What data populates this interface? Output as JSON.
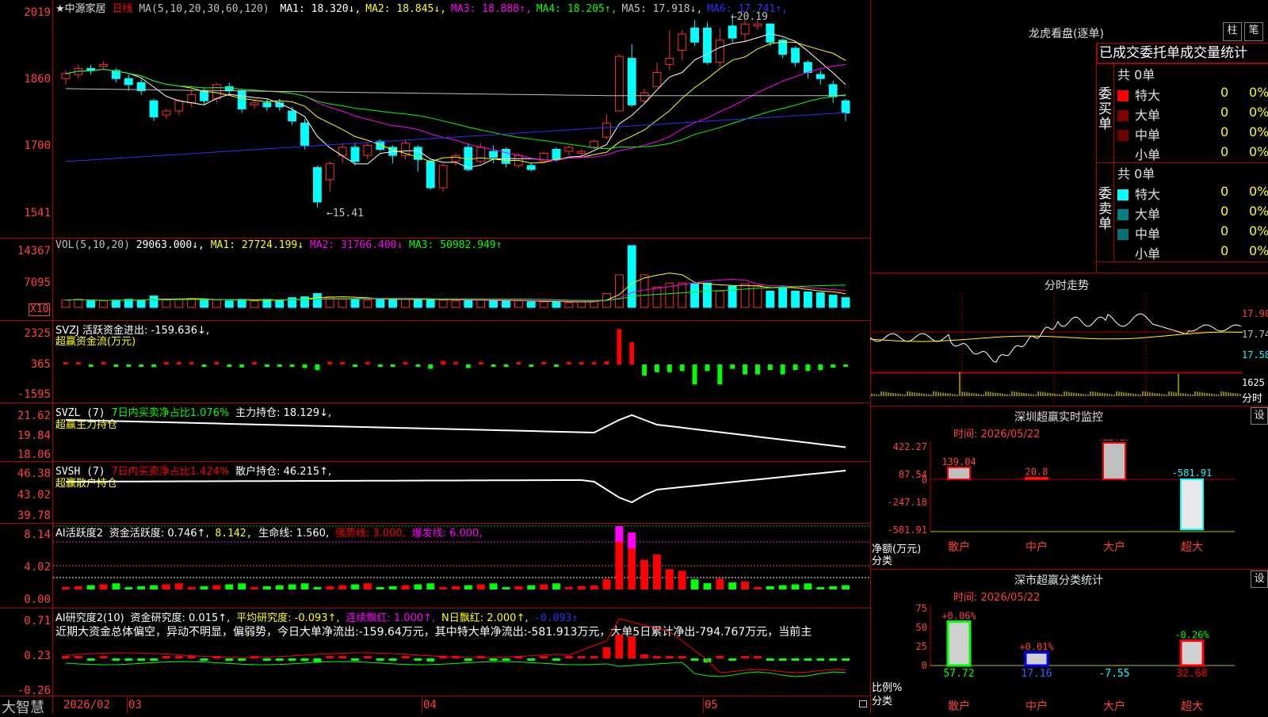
{
  "header": {
    "name": "★中源家居",
    "period": "日线",
    "ma_label": "MA(5,10,20,30,60,120)",
    "ma_items": [
      {
        "label": "MA1: 18.320",
        "arrow": "↓",
        "color": "#ffffff"
      },
      {
        "label": "MA2: 18.845",
        "arrow": "↓",
        "color": "#ffff00"
      },
      {
        "label": "MA3: 18.888",
        "arrow": "↑",
        "color": "#ff00ff"
      },
      {
        "label": "MA4: 18.205",
        "arrow": "↑",
        "color": "#00ff00"
      },
      {
        "label": "MA5: 17.918",
        "arrow": "↓",
        "color": "#c0c0c0"
      },
      {
        "label": "MA6: 17.741",
        "arrow": "↑",
        "color": "#3030ff"
      }
    ]
  },
  "price_panel": {
    "axis": [
      "2019",
      "1860",
      "1700",
      "1541"
    ],
    "high_mark": "20.19",
    "low_mark": "15.41"
  },
  "vol_panel": {
    "label": "VOL(5,10,20)",
    "value": "29063.000",
    "ma1": "MA1: 27724.199↓",
    "ma2": "MA2: 31766.400↓",
    "ma3": "MA3: 50982.949↑",
    "axis": [
      "14367",
      "7095",
      "X10"
    ]
  },
  "svzj_panel": {
    "label": "SVZJ  活跃资金进出: -159.636↓,",
    "sub": "超赢资金流(万元)",
    "axis": [
      "2325",
      "365",
      "-1595"
    ]
  },
  "svzl_panel": {
    "label": "SVZL (7)",
    "ratio": "7日内买卖净占比1.076%",
    "hold": "主力持仓: 18.129↓,",
    "sub": "超赢主力持仓",
    "axis": [
      "21.62",
      "19.84",
      "18.06"
    ]
  },
  "svsh_panel": {
    "label": "SVSH (7)",
    "ratio": "7日内买卖净占比1.424%",
    "hold": "散户持仓: 46.215↑,",
    "sub": "超赢散户持仓",
    "axis": [
      "46.38",
      "43.02",
      "39.78"
    ]
  },
  "ai1_panel": {
    "label": "AI活跃度2",
    "act": "资金活跃度: 0.746↑,",
    "v2": "8.142,",
    "life": "生命线: 1.560,",
    "strong": "强势线: 3.000,",
    "burst": "爆发线: 6.000,",
    "axis": [
      "8.14",
      "4.02",
      "0.00"
    ]
  },
  "ai2_panel": {
    "label": "AI研究度2(10)",
    "research": "资金研究度: 0.015↑,",
    "avg": "平均研究度: -0.093↑,",
    "cont": "连续飘红: 1.000↑,",
    "nday": "N日飘红: 2.000↑,",
    "last": "-0.093↑",
    "text": "近期大资金总体偏空，异动不明显，偏弱势，今日大单净流出:-159.64万元，其中特大单净流出:-581.913万元，大单5日累计净出-794.767万元，当前主",
    "axis": [
      "0.71",
      "0.23",
      "-0.26"
    ]
  },
  "bottom_axis": {
    "brand": "大智慧",
    "labels": [
      "2026/02",
      "03",
      "04",
      "05"
    ]
  },
  "right_panel": {
    "lhb": {
      "title": "龙虎看盘(逐单)",
      "btn1": "柱",
      "btn2": "笔",
      "tab": "已成交委托单成交量统计"
    },
    "buy": {
      "side": "委买单",
      "total": "共 0单",
      "rows": [
        {
          "name": "特大",
          "v": "0",
          "p": "0%",
          "color": "#ff0000"
        },
        {
          "name": "大单",
          "v": "0",
          "p": "0%",
          "color": "#800000"
        },
        {
          "name": "中单",
          "v": "0",
          "p": "0%",
          "color": "#700000"
        },
        {
          "name": "小单",
          "v": "0",
          "p": "0%",
          "color": "#000000"
        }
      ]
    },
    "sell": {
      "side": "委卖单",
      "total": "共 0单",
      "rows": [
        {
          "name": "特大",
          "v": "0",
          "p": "0%",
          "color": "#00ffff"
        },
        {
          "name": "大单",
          "v": "0",
          "p": "0%",
          "color": "#008080"
        },
        {
          "name": "中单",
          "v": "0",
          "p": "0%",
          "color": "#007070"
        },
        {
          "name": "小单",
          "v": "0",
          "p": "0%",
          "color": "#000000"
        }
      ]
    },
    "intraday": {
      "title": "分时走势",
      "p1": "17.90",
      "p2": "17.74",
      "p3": "17.58",
      "vol": "1625",
      "vol_unit": "分时"
    },
    "monitor": {
      "title": "深圳超赢实时监控",
      "set": "设",
      "time": "时间: 2026/05/22",
      "axis": [
        "422.27",
        "87.54",
        "0",
        "-247.18",
        "-581.91"
      ],
      "ylabel1": "净额(万元)",
      "ylabel2": "分类",
      "cats": [
        "散户",
        "中户",
        "大户",
        "超大"
      ],
      "vals": [
        "139.04",
        "20.8",
        "422.27",
        "-581.91"
      ]
    },
    "stats": {
      "title": "深市超赢分类统计",
      "set": "设",
      "time": "时间: 2026/05/22",
      "axis": [
        "75",
        "50",
        "25",
        "0"
      ],
      "ylabel1": "比例%",
      "ylabel2": "分类",
      "cats": [
        "散户",
        "中户",
        "大户",
        "超大"
      ],
      "pct": [
        "+0.06%",
        "+0.01%",
        "",
        "-0.26%"
      ],
      "vals": [
        "57.72",
        "17.16",
        "-7.55",
        "32.68"
      ]
    }
  },
  "chart_data": {
    "type": "candlestick",
    "title": "中源家居 日线",
    "x_labels": [
      "2026/02",
      "03",
      "04",
      "05"
    ],
    "ylim": [
      15.41,
      20.19
    ],
    "candles": [
      [
        18.6,
        18.72,
        18.45,
        18.8
      ],
      [
        18.7,
        18.85,
        18.6,
        18.95
      ],
      [
        18.85,
        18.8,
        18.7,
        18.95
      ],
      [
        18.9,
        18.95,
        18.8,
        19.02
      ],
      [
        18.8,
        18.6,
        18.5,
        18.85
      ],
      [
        18.6,
        18.45,
        18.3,
        18.7
      ],
      [
        18.5,
        18.3,
        18.2,
        18.6
      ],
      [
        18.05,
        17.65,
        17.55,
        18.1
      ],
      [
        17.7,
        17.8,
        17.6,
        17.85
      ],
      [
        17.8,
        18.05,
        17.7,
        18.1
      ],
      [
        18.0,
        18.2,
        17.9,
        18.3
      ],
      [
        18.3,
        18.05,
        17.95,
        18.35
      ],
      [
        18.1,
        18.45,
        18.0,
        18.5
      ],
      [
        18.4,
        18.3,
        18.2,
        18.5
      ],
      [
        18.3,
        17.85,
        17.75,
        18.35
      ],
      [
        17.95,
        18.0,
        17.85,
        18.1
      ],
      [
        18.0,
        17.9,
        17.8,
        18.1
      ],
      [
        18.0,
        17.9,
        17.8,
        18.1
      ],
      [
        17.8,
        17.55,
        17.45,
        17.9
      ],
      [
        17.5,
        16.95,
        16.85,
        17.6
      ],
      [
        16.4,
        15.55,
        15.41,
        16.45
      ],
      [
        16.1,
        16.5,
        15.8,
        16.55
      ],
      [
        16.7,
        16.9,
        16.5,
        17.0
      ],
      [
        16.9,
        16.55,
        16.45,
        17.0
      ],
      [
        16.7,
        16.95,
        16.6,
        17.0
      ],
      [
        17.05,
        16.85,
        16.8,
        17.1
      ],
      [
        16.9,
        16.7,
        16.5,
        16.95
      ],
      [
        16.7,
        17.0,
        16.6,
        17.1
      ],
      [
        16.9,
        16.6,
        16.3,
        16.95
      ],
      [
        16.55,
        15.9,
        15.85,
        16.6
      ],
      [
        15.9,
        16.45,
        15.8,
        16.5
      ],
      [
        16.55,
        16.7,
        16.45,
        16.75
      ],
      [
        16.9,
        16.35,
        16.3,
        17.0
      ],
      [
        16.55,
        16.9,
        16.5,
        17.0
      ],
      [
        16.8,
        16.65,
        16.5,
        16.95
      ],
      [
        16.85,
        16.5,
        16.4,
        16.9
      ],
      [
        16.45,
        16.7,
        16.4,
        16.75
      ],
      [
        16.45,
        16.35,
        16.3,
        16.5
      ],
      [
        16.55,
        16.75,
        16.5,
        16.8
      ],
      [
        16.85,
        16.6,
        16.55,
        16.9
      ],
      [
        16.8,
        16.9,
        16.7,
        16.95
      ],
      [
        16.75,
        16.8,
        16.65,
        16.85
      ],
      [
        16.9,
        17.05,
        16.85,
        17.1
      ],
      [
        17.15,
        17.5,
        17.1,
        17.7
      ],
      [
        17.8,
        19.15,
        17.8,
        19.2
      ],
      [
        19.1,
        17.95,
        17.9,
        19.45
      ],
      [
        18.05,
        18.25,
        18.0,
        18.35
      ],
      [
        18.4,
        18.75,
        18.4,
        19.0
      ],
      [
        18.95,
        19.1,
        18.8,
        19.8
      ],
      [
        19.3,
        19.7,
        19.05,
        19.8
      ],
      [
        19.85,
        19.5,
        19.4,
        20.05
      ],
      [
        19.85,
        19.0,
        18.95,
        20.0
      ],
      [
        19.0,
        19.55,
        18.9,
        19.85
      ],
      [
        19.9,
        19.6,
        19.5,
        20.19
      ],
      [
        19.7,
        19.95,
        19.5,
        20.05
      ],
      [
        19.9,
        19.95,
        19.8,
        20.05
      ],
      [
        19.95,
        19.5,
        19.4,
        19.95
      ],
      [
        19.55,
        19.2,
        19.1,
        19.6
      ],
      [
        19.35,
        19.0,
        18.9,
        19.4
      ],
      [
        19.0,
        18.75,
        18.6,
        19.05
      ],
      [
        18.7,
        18.6,
        18.45,
        18.8
      ],
      [
        18.45,
        18.15,
        18.0,
        18.55
      ],
      [
        18.05,
        17.75,
        17.55,
        18.1
      ]
    ],
    "volume": [
      0.9,
      1.0,
      0.8,
      0.8,
      0.9,
      1.0,
      0.9,
      1.4,
      0.9,
      1.0,
      1.1,
      0.9,
      0.9,
      0.8,
      1.0,
      0.8,
      1.0,
      0.8,
      1.2,
      1.3,
      1.7,
      1.3,
      1.0,
      1.0,
      0.9,
      1.1,
      1.0,
      1.0,
      0.9,
      1.0,
      0.9,
      0.8,
      0.9,
      0.9,
      0.8,
      0.8,
      0.8,
      0.7,
      0.7,
      0.7,
      0.6,
      0.7,
      0.8,
      1.7,
      4.0,
      7.6,
      4.0,
      2.5,
      3.0,
      3.0,
      2.9,
      3.0,
      2.0,
      2.6,
      2.9,
      2.7,
      2.0,
      2.4,
      2.0,
      1.9,
      1.8,
      1.5,
      1.2
    ]
  }
}
